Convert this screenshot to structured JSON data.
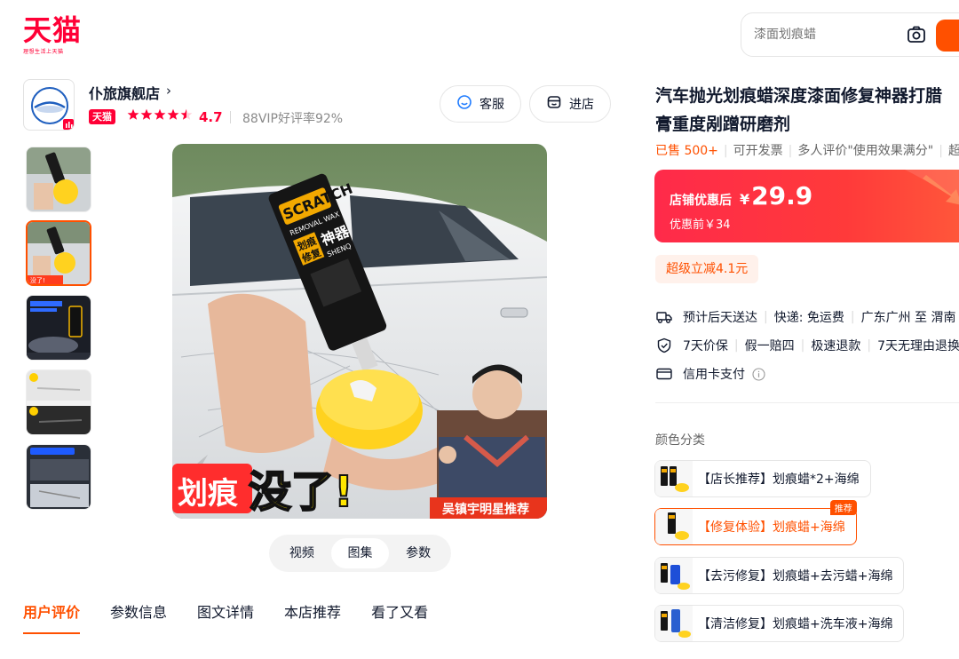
{
  "header": {
    "logo_text": "天猫",
    "logo_slogan": "理想生活上天猫",
    "search_placeholder": "漆面划痕蜡"
  },
  "shop": {
    "name": "仆旅旗舰店",
    "chevron": "›",
    "badge": "天猫",
    "stars": 4.5,
    "rating": "4.7",
    "vip_text": "88VIP好评率92%",
    "service_label": "客服",
    "enter_label": "进店"
  },
  "gallery": {
    "thumbnail_count": 5,
    "active_thumbnail": 2,
    "main_image": {
      "tube_brand": "SCRATCH",
      "tube_sub": "REMOVAL WAX",
      "tube_cn1": "划痕",
      "tube_cn2": "修复",
      "tube_cn3": "神器",
      "tube_pinyin": "SHENQ",
      "headline_left": "划痕",
      "headline_right": "没了!",
      "endorser": "吴镇宇明星推荐"
    },
    "media_tabs": [
      "视频",
      "图集",
      "参数"
    ],
    "active_media_tab": 1
  },
  "bottom_nav": {
    "items": [
      "用户评价",
      "参数信息",
      "图文详情",
      "本店推荐",
      "看了又看"
    ],
    "active": 0
  },
  "product": {
    "title_line1": "汽车抛光划痕蜡深度漆面修复神器打腊",
    "title_line2": "膏重度剐蹭研磨剂",
    "sold": "已售 500+",
    "invoice": "可开发票",
    "review_tag": "多人评价\"使用效果满分\"",
    "more": "超",
    "price_label": "店铺优惠后",
    "currency": "¥",
    "price": "29.9",
    "original_price": "优惠前￥34",
    "promo": "超级立减4.1元",
    "delivery": {
      "eta": "预计后天送达",
      "shipping": "快递: 免运费",
      "route": "广东广州 至 渭南"
    },
    "guarantees": [
      "7天价保",
      "假一赔四",
      "极速退款",
      "7天无理由退换"
    ],
    "payment": "信用卡支付",
    "color_label": "颜色分类",
    "skus": [
      {
        "label": "【店长推荐】划痕蜡*2+海绵",
        "badge": ""
      },
      {
        "label": "【修复体验】划痕蜡+海绵",
        "badge": "推荐"
      },
      {
        "label": "【去污修复】划痕蜡+去污蜡+海绵",
        "badge": ""
      },
      {
        "label": "【清洁修复】划痕蜡+洗车液+海绵",
        "badge": ""
      }
    ],
    "active_sku": 1
  },
  "colors": {
    "brand_red": "#ff0036",
    "accent_orange": "#ff5000"
  }
}
